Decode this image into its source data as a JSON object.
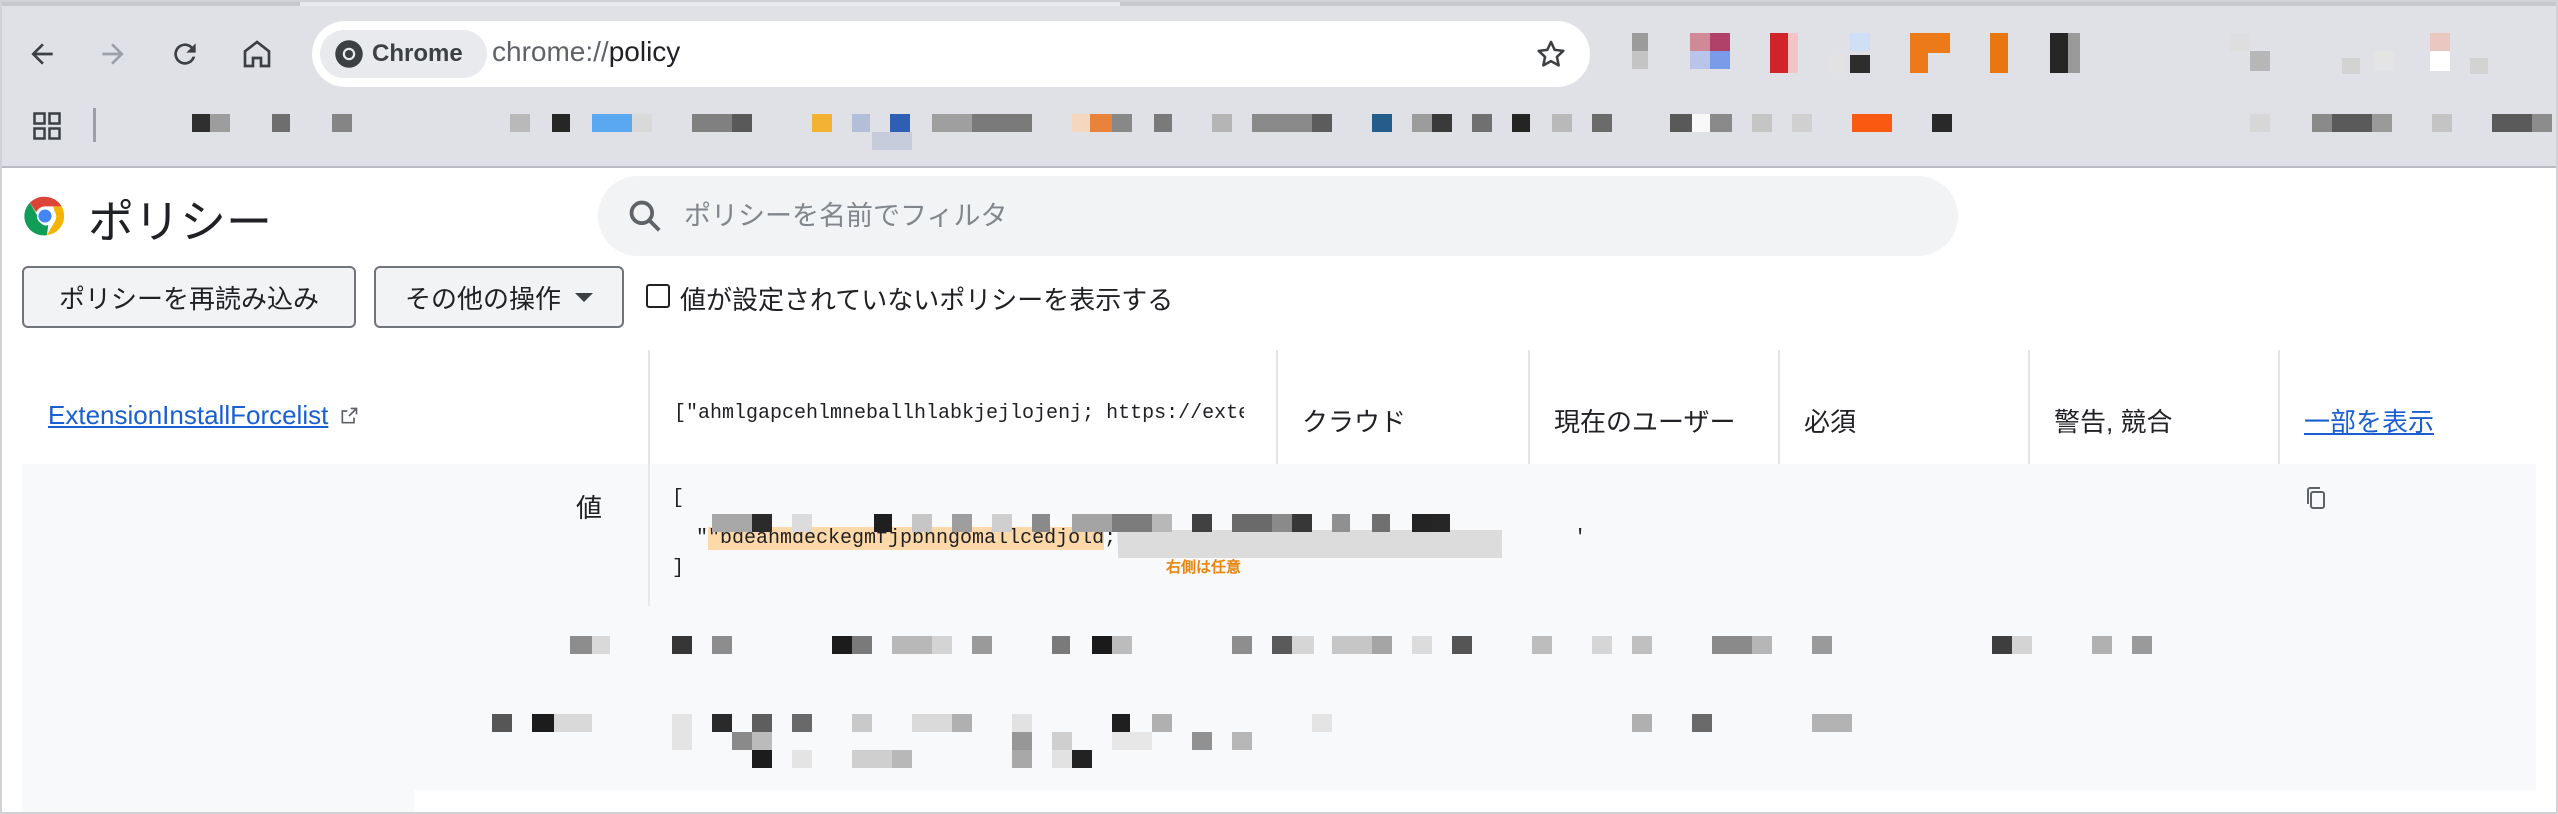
{
  "browser": {
    "chip_label": "Chrome",
    "url_scheme": "chrome://",
    "url_path": "policy",
    "icons": [
      "back-icon",
      "forward-icon",
      "reload-icon",
      "home-icon",
      "star-icon",
      "apps-icon"
    ]
  },
  "page": {
    "title": "ポリシー",
    "search_placeholder": "ポリシーを名前でフィルタ",
    "reload_button": "ポリシーを再読み込み",
    "more_actions_button": "その他の操作",
    "show_unset_label": "値が設定されていないポリシーを表示する"
  },
  "policy_row": {
    "name": "ExtensionInstallForcelist",
    "value_preview": "[\"ahmlgapcehlmneballhlabkjejlojenj; https://extensio…",
    "source": "クラウド",
    "scope": "現在のユーザー",
    "level": "必須",
    "status": "警告, 競合",
    "show_more": "一部を表示"
  },
  "value_detail": {
    "label": "値",
    "open_bracket": "[",
    "entry_id": "\"bdeanmdeckegmfjpbnngomallcedjold",
    "entry_suffix": ";https:",
    "entry_end": "'",
    "close_bracket": "]",
    "annotation": "右側は任意"
  },
  "colors": {
    "link": "#1a5fd1",
    "highlight": "#fdd9a9",
    "annotation": "#e8860f",
    "chrome_bg": "#dfe1e6"
  }
}
